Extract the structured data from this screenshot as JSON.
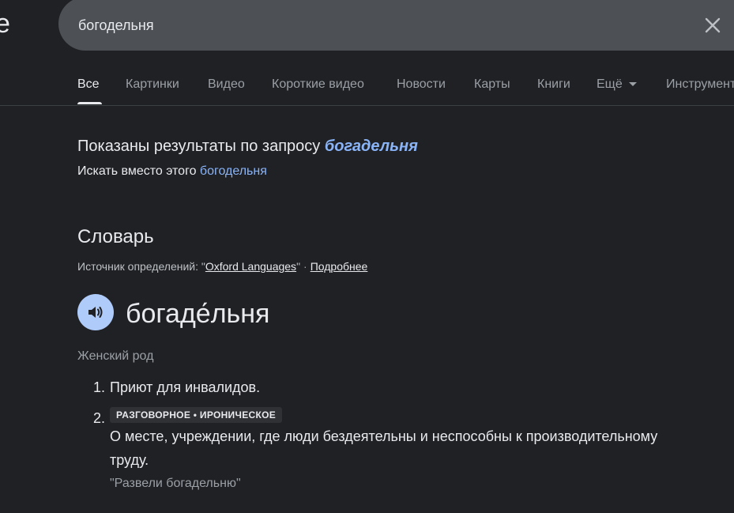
{
  "header": {
    "logo_fragment": "e",
    "search": {
      "value": "богодельня"
    }
  },
  "tabs": [
    {
      "label": "Все",
      "active": true
    },
    {
      "label": "Картинки"
    },
    {
      "label": "Видео"
    },
    {
      "label": "Короткие видео"
    },
    {
      "label": "Новости"
    },
    {
      "label": "Карты"
    },
    {
      "label": "Книги"
    },
    {
      "label": "Ещё"
    },
    {
      "label": "Инструменты"
    }
  ],
  "correction": {
    "shown_prefix": "Показаны результаты по запросу ",
    "corrected_query": "богадельня",
    "instead_prefix": "Искать вместо этого ",
    "original_query": "богодельня"
  },
  "dictionary": {
    "title": "Словарь",
    "source_prefix": "Источник определений: \"",
    "source_name": "Oxford Languages",
    "source_suffix": "\"",
    "separator": "·",
    "more_link": "Подробнее",
    "headword": "богаде́льня",
    "part_of_speech": "Женский род",
    "definitions": [
      {
        "num": "1.",
        "text": "Приют для инвалидов."
      },
      {
        "num": "2.",
        "label": "РАЗГОВОРНОЕ • ИРОНИЧЕСКОЕ",
        "text_line1": "О месте, учреждении, где люди бездеятельны и неспособны к производительному",
        "text_line2": "труду.",
        "example": "\"Развели богадельню\""
      }
    ]
  },
  "colors": {
    "background": "#202124",
    "link": "#8ab4f8",
    "speaker_bg": "#aecbfa"
  }
}
